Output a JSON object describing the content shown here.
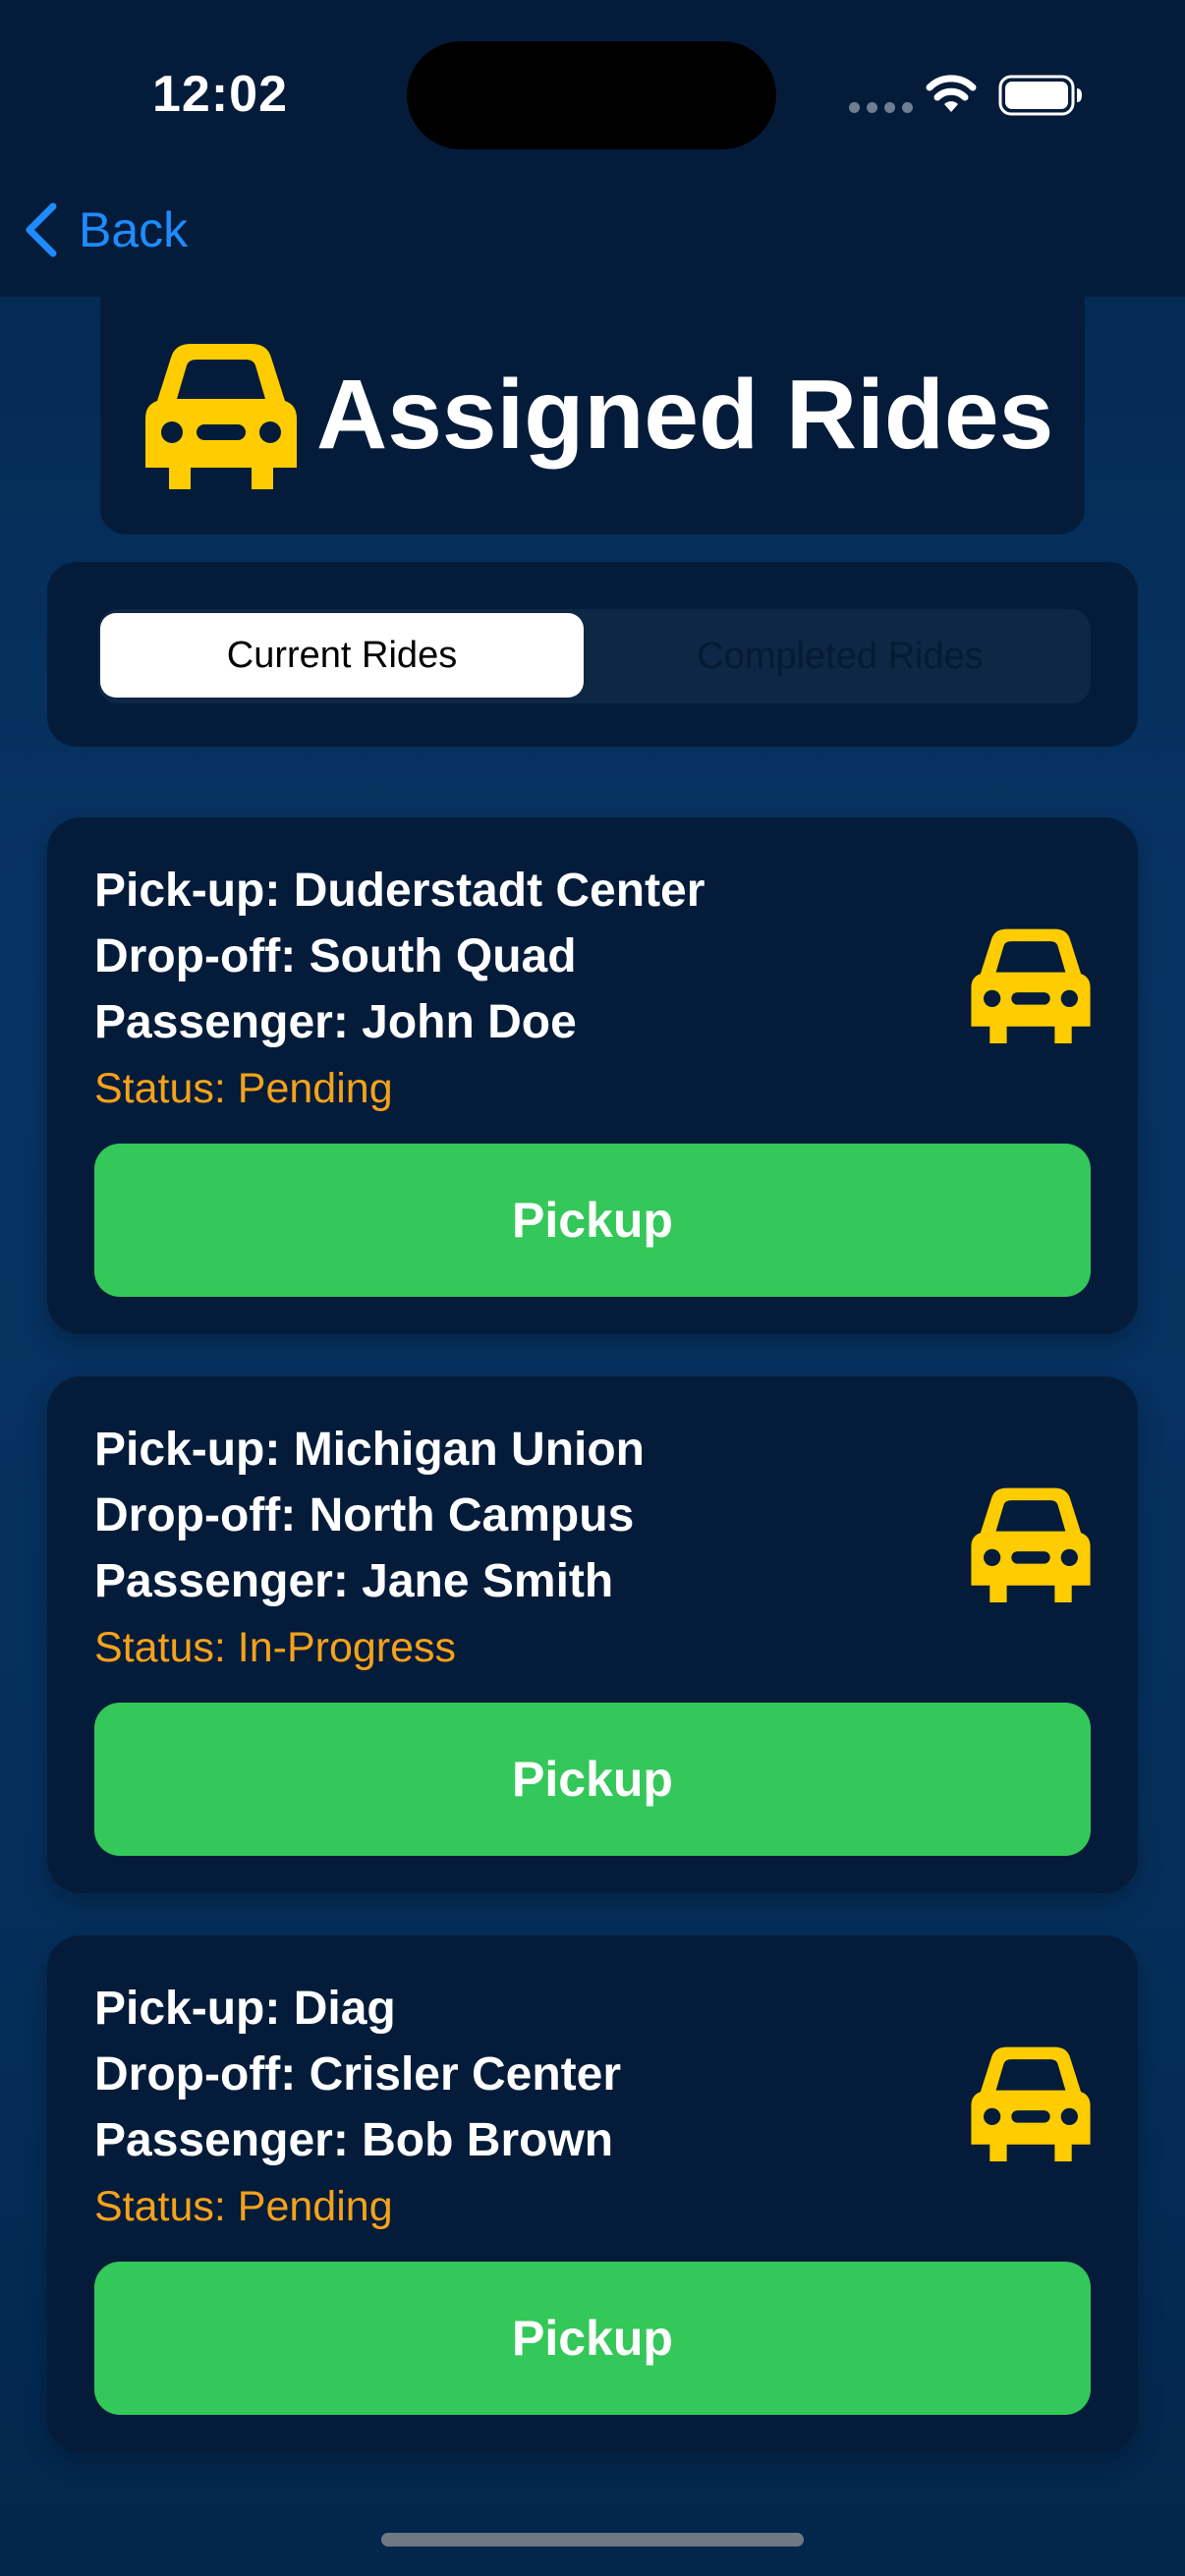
{
  "status_bar": {
    "time": "12:02"
  },
  "nav": {
    "back_label": "Back"
  },
  "header": {
    "title": "Assigned Rides",
    "icon": "car-icon",
    "icon_color": "#ffcc00"
  },
  "tabs": [
    {
      "label": "Current Rides",
      "selected": true
    },
    {
      "label": "Completed Rides",
      "selected": false
    }
  ],
  "colors": {
    "accent_blue": "#1e8cff",
    "status_orange": "#f5a21a",
    "button_green": "#34c759",
    "card_bg": "#041c3a"
  },
  "rides": [
    {
      "pickup": "Pick-up: Duderstadt Center",
      "dropoff": "Drop-off: South Quad",
      "passenger": "Passenger: John Doe",
      "status": "Status: Pending",
      "button_label": "Pickup"
    },
    {
      "pickup": "Pick-up: Michigan Union",
      "dropoff": "Drop-off: North Campus",
      "passenger": "Passenger: Jane Smith",
      "status": "Status: In-Progress",
      "button_label": "Pickup"
    },
    {
      "pickup": "Pick-up: Diag",
      "dropoff": "Drop-off: Crisler Center",
      "passenger": "Passenger: Bob Brown",
      "status": "Status: Pending",
      "button_label": "Pickup"
    }
  ]
}
